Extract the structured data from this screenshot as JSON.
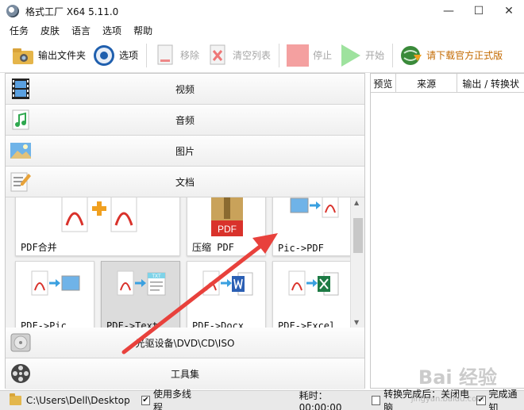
{
  "window": {
    "title": "格式工厂 X64 5.11.0",
    "controls": [
      "—",
      "☐",
      "✕"
    ]
  },
  "menu": [
    "任务",
    "皮肤",
    "语言",
    "选项",
    "帮助"
  ],
  "toolbar": {
    "output_folder": "输出文件夹",
    "options": "选项",
    "remove": "移除",
    "clear_list": "清空列表",
    "stop": "停止",
    "start": "开始",
    "download": "请下载官方正式版",
    "colors": {
      "stop_square": "#f4a0a0",
      "start_play": "#9ee29e",
      "download_text": "#c36a00"
    }
  },
  "categories": {
    "video": "视频",
    "audio": "音频",
    "image": "图片",
    "document": "文档",
    "optical": "光驱设备\\DVD\\CD\\ISO",
    "tools": "工具集"
  },
  "tiles": {
    "pdf_merge": "PDF合并",
    "compress_pdf": "压缩 PDF",
    "pic_to_pdf": "Pic->PDF",
    "pdf_to_pic": "PDF->Pic",
    "pdf_to_text": "PDF->Text",
    "pdf_to_docx": "PDF->Docx",
    "pdf_to_excel": "PDF->Excel",
    "pdf_badge": "PDF",
    "txt_badge": "TXT"
  },
  "task_table": {
    "columns": [
      "预览",
      "来源",
      "输出 / 转换状"
    ]
  },
  "statusbar": {
    "path": "C:\\Users\\Dell\\Desktop",
    "multithread": "使用多线程",
    "elapsed": "耗时：00:00:00",
    "after_done": "转换完成后：关闭电脑",
    "notify": "完成通知"
  },
  "watermark": {
    "text": "Bai 经验",
    "sub": "jingyan.baidu.com"
  },
  "colors": {
    "arrow": "#e8413c",
    "pdf_red": "#d9322b"
  }
}
